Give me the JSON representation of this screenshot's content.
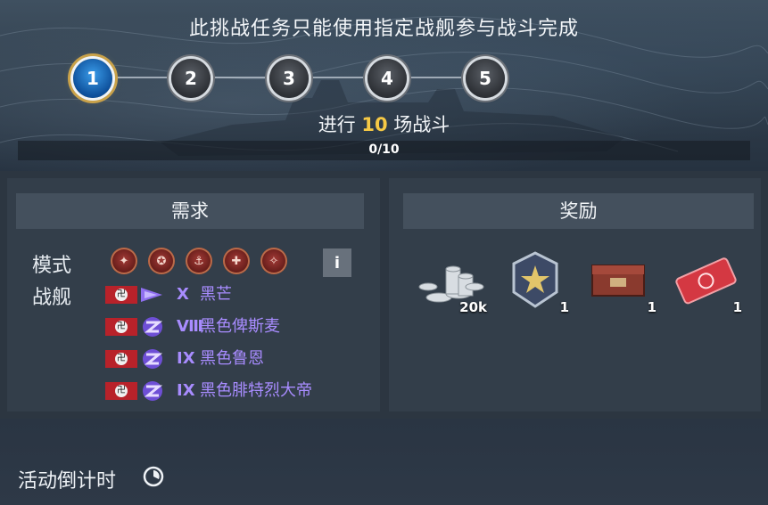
{
  "header": {
    "title": "此挑战任务只能使用指定战舰参与战斗完成",
    "steps": [
      "1",
      "2",
      "3",
      "4",
      "5"
    ],
    "active_step": 1,
    "subtitle_prefix": "进行 ",
    "subtitle_count": "10",
    "subtitle_suffix": " 场战斗",
    "progress_text": "0/10",
    "progress_fraction": 0.0
  },
  "requirements": {
    "heading": "需求",
    "mode_label": "模式",
    "ship_label": "战舰",
    "mode_icons": [
      "battle-mode-icon",
      "battle-mode-icon",
      "battle-mode-icon",
      "battle-mode-icon",
      "battle-mode-icon"
    ],
    "info_label": "i",
    "ships": [
      {
        "tier": "X",
        "name": "黑芒",
        "class": "cruiser-icon"
      },
      {
        "tier": "Ⅷ",
        "name": "黑色俾斯麦",
        "class": "battleship-icon"
      },
      {
        "tier": "IX",
        "name": "黑色鲁恩",
        "class": "battleship-icon"
      },
      {
        "tier": "IX",
        "name": "黑色腓特烈大帝",
        "class": "battleship-icon"
      }
    ],
    "ship_color": "#a88cff",
    "flag_color": "#b8222a"
  },
  "rewards": {
    "heading": "奖励",
    "items": [
      {
        "icon": "silver-credits-icon",
        "count": "20k"
      },
      {
        "icon": "commander-xp-badge-icon",
        "count": "1"
      },
      {
        "icon": "supply-container-icon",
        "count": "1"
      },
      {
        "icon": "coupon-ticket-icon",
        "count": "1"
      }
    ]
  },
  "footer": {
    "countdown_label": "活动倒计时"
  },
  "colors": {
    "highlight": "#f6c945",
    "active_step": "#1f74c8"
  }
}
